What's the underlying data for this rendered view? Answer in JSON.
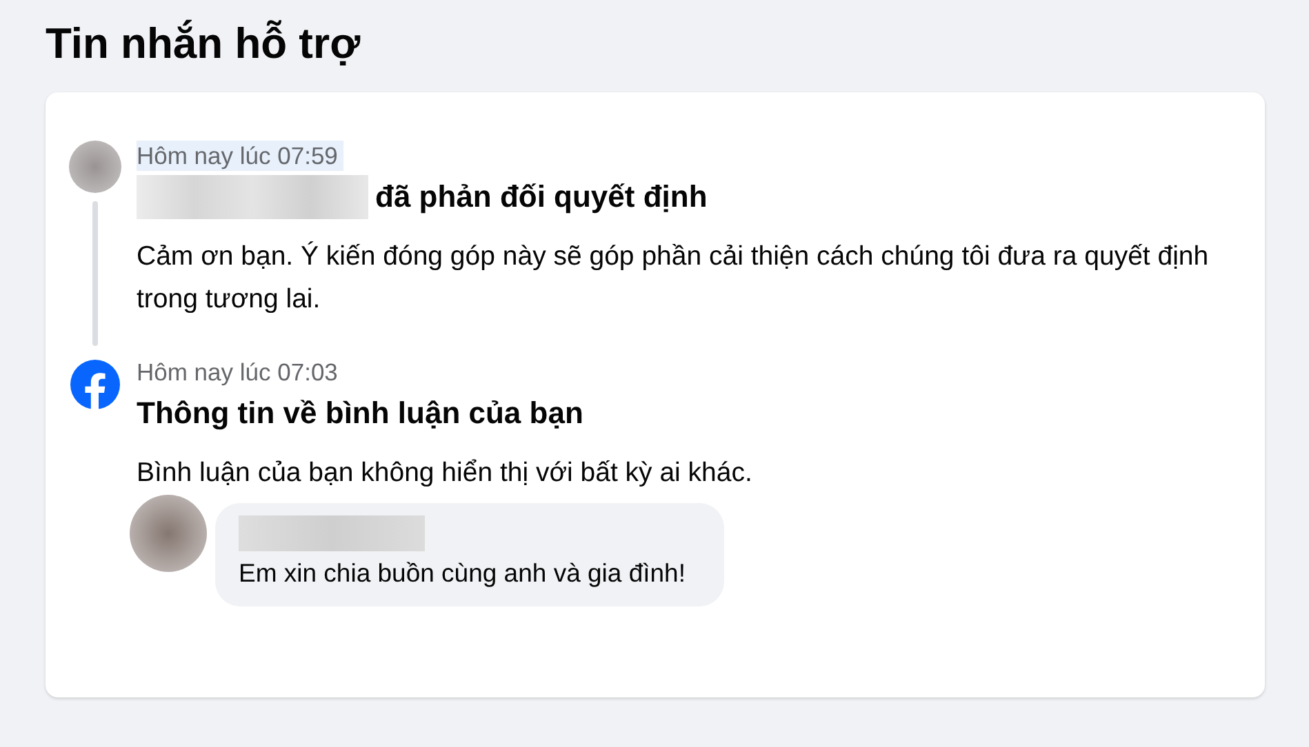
{
  "title": "Tin nhắn hỗ trợ",
  "messages": [
    {
      "kind": "user",
      "time": "Hôm nay lúc 07:59",
      "time_highlighted": true,
      "title": "đã phản đối quyết định",
      "body": "Cảm ơn bạn. Ý kiến đóng góp này sẽ góp phần cải thiện cách chúng tôi đưa ra quyết định trong tương lai."
    },
    {
      "kind": "facebook",
      "time": "Hôm nay lúc 07:03",
      "time_highlighted": false,
      "title": "Thông tin về bình luận của bạn",
      "body": "Bình luận của bạn không hiển thị với bất kỳ ai khác.",
      "comment": {
        "text": "Em xin chia buồn cùng anh và gia đình!"
      }
    }
  ]
}
